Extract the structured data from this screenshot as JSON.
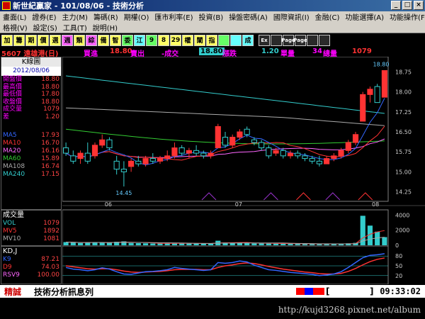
{
  "title": "新世紀贏家 - 101/08/06 - 技術分析",
  "menus": {
    "row1": [
      "畫面(L)",
      "證券(E)",
      "主力(M)",
      "籌碼(R)",
      "期權(O)",
      "匯市利率(E)",
      "投資(B)",
      "操盤密碼(A)",
      "國際資訊(I)",
      "金融(C)",
      "功能選擇(A)",
      "功能操作(F)"
    ],
    "row2": [
      "格視(V)",
      "設定(S)",
      "工具(T)",
      "說明(H)"
    ]
  },
  "toolbar": [
    {
      "label": "加",
      "color": "#ffff66"
    },
    {
      "label": "籌",
      "color": "#ffff66"
    },
    {
      "label": "期",
      "color": "#ffff66"
    },
    {
      "label": "價",
      "color": "#ffff66"
    },
    {
      "label": "選",
      "color": "#ffff66"
    },
    {
      "label": "週",
      "color": "#ff66ff"
    },
    {
      "label": "類",
      "color": "#ffff66"
    },
    {
      "label": "綜",
      "color": "#ff66ff"
    },
    {
      "label": "備",
      "color": "#ffff66"
    },
    {
      "label": "智",
      "color": "#ffff66"
    },
    {
      "label": "委",
      "color": "#66ff66"
    },
    {
      "label": "江",
      "color": "#66ffff"
    },
    {
      "label": "9",
      "color": "#66ff66"
    },
    {
      "label": "8",
      "color": "#ffff66"
    },
    {
      "label": "29",
      "color": "#ffff66"
    },
    {
      "label": "權",
      "color": "#ffff66"
    },
    {
      "label": "闡",
      "color": "#ffff66"
    },
    {
      "label": "指",
      "color": "#ffff66"
    },
    {
      "label": "",
      "color": "#66ff66"
    },
    {
      "label": "",
      "color": "#66ffff"
    },
    {
      "label": "成",
      "color": "#66ffff"
    },
    {
      "label": "Ex",
      "color": "#2a2a2a"
    },
    {
      "label": "",
      "color": "#2a2a2a"
    },
    {
      "label": "Page",
      "color": "#2a2a2a"
    },
    {
      "label": "Page",
      "color": "#2a2a2a"
    },
    {
      "label": "",
      "color": "#2a2a2a"
    },
    {
      "label": "",
      "color": "#2a2a2a"
    }
  ],
  "quote": {
    "code_name": "5607 遠雄港(日)",
    "bid_label": "買進",
    "bid": "18.80",
    "ask_label": "賣出",
    "change_label": "-成交",
    "last": "18.80",
    "limit_label": "漲跌",
    "change": "1.20",
    "unit_label": "單量",
    "total": "34",
    "total_label": "總量",
    "volume": "1079"
  },
  "info": {
    "header": "K線圖",
    "date": "2012/08/06",
    "fields": [
      {
        "k": "開盤價",
        "v": "18.80"
      },
      {
        "k": "最高價",
        "v": "18.80"
      },
      {
        "k": "最低價",
        "v": "17.80"
      },
      {
        "k": "收盤價",
        "v": "18.80"
      },
      {
        "k": "成交量",
        "v": "1079"
      },
      {
        "k": "差",
        "v": "1.20"
      }
    ],
    "ma": [
      {
        "k": "MA5",
        "v": "17.93",
        "color": "#3366ff"
      },
      {
        "k": "MA10",
        "v": "16.70",
        "color": "#ff3333"
      },
      {
        "k": "MA20",
        "v": "16.16",
        "color": "#ff66ff"
      },
      {
        "k": "MA60",
        "v": "15.89",
        "color": "#33cc33"
      },
      {
        "k": "MA108",
        "v": "16.74",
        "color": "#aaaaaa"
      },
      {
        "k": "MA240",
        "v": "17.15",
        "color": "#33cccc"
      }
    ]
  },
  "volume_panel": {
    "header": "成交量",
    "items": [
      {
        "k": "VOL",
        "v": "1079",
        "color": "#33cccc"
      },
      {
        "k": "MV5",
        "v": "1892",
        "color": "#ff3333"
      },
      {
        "k": "MV10",
        "v": "1081",
        "color": "#aaaaaa"
      }
    ],
    "ticks": [
      "4000",
      "2000",
      "0"
    ]
  },
  "kd_panel": {
    "header": "KD,J",
    "items": [
      {
        "k": "K9",
        "v": "87.21",
        "color": "#3366ff"
      },
      {
        "k": "D9",
        "v": "74.03",
        "color": "#ff3333"
      },
      {
        "k": "RSV9",
        "v": "100.00",
        "color": "#ff66ff"
      }
    ],
    "ticks": [
      "80",
      "50",
      "20"
    ]
  },
  "price_axis": [
    "18.75",
    "18.00",
    "17.25",
    "16.50",
    "15.75",
    "15.00",
    "14.25"
  ],
  "date_axis": [
    "06",
    "07",
    "08"
  ],
  "annotations": {
    "high": "18.80",
    "low": "14.45"
  },
  "bottom": {
    "brand": "精誠",
    "news_label": "技術分析訊息列",
    "bracket_open": "[",
    "bracket_close": "]",
    "clock": "09:33:02"
  },
  "footer": "http://kujd3268.pixnet.net/album",
  "chart_data": {
    "type": "candlestick",
    "ylim": [
      14.0,
      19.0
    ],
    "candles": [
      {
        "o": 15.9,
        "h": 16.1,
        "l": 15.6,
        "c": 15.7
      },
      {
        "o": 15.6,
        "h": 15.8,
        "l": 15.3,
        "c": 15.4
      },
      {
        "o": 15.5,
        "h": 15.8,
        "l": 15.3,
        "c": 15.7
      },
      {
        "o": 15.7,
        "h": 16.1,
        "l": 15.3,
        "c": 15.4
      },
      {
        "o": 15.6,
        "h": 16.1,
        "l": 15.5,
        "c": 16.0
      },
      {
        "o": 16.0,
        "h": 16.4,
        "l": 15.9,
        "c": 16.2
      },
      {
        "o": 16.2,
        "h": 16.3,
        "l": 15.8,
        "c": 15.9
      },
      {
        "o": 15.4,
        "h": 15.6,
        "l": 14.9,
        "c": 15.1
      },
      {
        "o": 15.1,
        "h": 15.4,
        "l": 14.45,
        "c": 15.0
      },
      {
        "o": 15.2,
        "h": 15.5,
        "l": 15.0,
        "c": 15.4
      },
      {
        "o": 15.4,
        "h": 15.6,
        "l": 15.2,
        "c": 15.3
      },
      {
        "o": 15.3,
        "h": 15.6,
        "l": 15.2,
        "c": 15.5
      },
      {
        "o": 15.5,
        "h": 15.7,
        "l": 15.3,
        "c": 15.4
      },
      {
        "o": 15.4,
        "h": 15.6,
        "l": 15.3,
        "c": 15.5
      },
      {
        "o": 15.5,
        "h": 15.8,
        "l": 15.4,
        "c": 15.6
      },
      {
        "o": 15.6,
        "h": 16.1,
        "l": 15.5,
        "c": 15.9
      },
      {
        "o": 15.9,
        "h": 16.0,
        "l": 15.6,
        "c": 15.7
      },
      {
        "o": 15.7,
        "h": 15.9,
        "l": 15.5,
        "c": 15.8
      },
      {
        "o": 15.8,
        "h": 16.0,
        "l": 15.6,
        "c": 15.7
      },
      {
        "o": 15.7,
        "h": 15.8,
        "l": 15.5,
        "c": 15.6
      },
      {
        "o": 15.6,
        "h": 15.8,
        "l": 15.5,
        "c": 15.7
      },
      {
        "o": 15.9,
        "h": 16.8,
        "l": 15.9,
        "c": 16.7
      },
      {
        "o": 16.3,
        "h": 16.5,
        "l": 15.9,
        "c": 16.0
      },
      {
        "o": 16.0,
        "h": 16.4,
        "l": 15.9,
        "c": 16.3
      },
      {
        "o": 16.3,
        "h": 16.6,
        "l": 16.2,
        "c": 16.5
      },
      {
        "o": 16.6,
        "h": 16.7,
        "l": 16.3,
        "c": 16.4
      },
      {
        "o": 16.2,
        "h": 16.3,
        "l": 16.0,
        "c": 16.1
      },
      {
        "o": 16.1,
        "h": 16.2,
        "l": 15.8,
        "c": 15.9
      },
      {
        "o": 15.9,
        "h": 16.0,
        "l": 15.5,
        "c": 15.6
      },
      {
        "o": 15.7,
        "h": 15.9,
        "l": 15.6,
        "c": 15.8
      },
      {
        "o": 15.8,
        "h": 15.9,
        "l": 15.5,
        "c": 15.6
      },
      {
        "o": 15.6,
        "h": 15.8,
        "l": 15.5,
        "c": 15.7
      },
      {
        "o": 15.7,
        "h": 15.8,
        "l": 15.5,
        "c": 15.6
      },
      {
        "o": 15.6,
        "h": 15.7,
        "l": 15.4,
        "c": 15.5
      },
      {
        "o": 15.5,
        "h": 15.6,
        "l": 15.3,
        "c": 15.4
      },
      {
        "o": 15.4,
        "h": 15.6,
        "l": 15.2,
        "c": 15.3
      },
      {
        "o": 15.3,
        "h": 15.6,
        "l": 15.3,
        "c": 15.5
      },
      {
        "o": 15.5,
        "h": 15.7,
        "l": 15.4,
        "c": 15.6
      },
      {
        "o": 15.6,
        "h": 15.9,
        "l": 15.5,
        "c": 15.8
      },
      {
        "o": 15.8,
        "h": 16.2,
        "l": 15.7,
        "c": 16.1
      },
      {
        "o": 16.1,
        "h": 16.5,
        "l": 16.0,
        "c": 16.4
      },
      {
        "o": 16.9,
        "h": 18.0,
        "l": 16.9,
        "c": 17.9
      },
      {
        "o": 17.9,
        "h": 18.2,
        "l": 17.6,
        "c": 18.1
      },
      {
        "o": 18.2,
        "h": 18.3,
        "l": 17.6,
        "c": 17.6
      },
      {
        "o": 17.8,
        "h": 18.8,
        "l": 17.8,
        "c": 18.8
      }
    ],
    "volume": [
      420,
      380,
      300,
      350,
      410,
      390,
      330,
      460,
      520,
      300,
      280,
      260,
      240,
      230,
      250,
      280,
      260,
      240,
      230,
      220,
      210,
      600,
      380,
      300,
      330,
      290,
      250,
      240,
      230,
      220,
      210,
      200,
      190,
      180,
      170,
      160,
      170,
      180,
      200,
      260,
      320,
      3900,
      2600,
      1800,
      1079
    ],
    "k": [
      45,
      40,
      38,
      35,
      38,
      44,
      40,
      32,
      25,
      24,
      28,
      32,
      33,
      35,
      38,
      45,
      42,
      40,
      38,
      36,
      38,
      60,
      58,
      60,
      65,
      62,
      52,
      45,
      38,
      36,
      33,
      30,
      28,
      26,
      24,
      20,
      22,
      25,
      32,
      45,
      60,
      75,
      82,
      84,
      87.21
    ],
    "d": [
      50,
      47,
      44,
      41,
      40,
      41,
      41,
      38,
      34,
      31,
      30,
      31,
      32,
      33,
      35,
      38,
      39,
      39,
      39,
      38,
      38,
      45,
      50,
      53,
      57,
      59,
      57,
      53,
      48,
      44,
      40,
      37,
      34,
      31,
      29,
      26,
      25,
      25,
      27,
      33,
      42,
      53,
      63,
      70,
      74.03
    ]
  }
}
